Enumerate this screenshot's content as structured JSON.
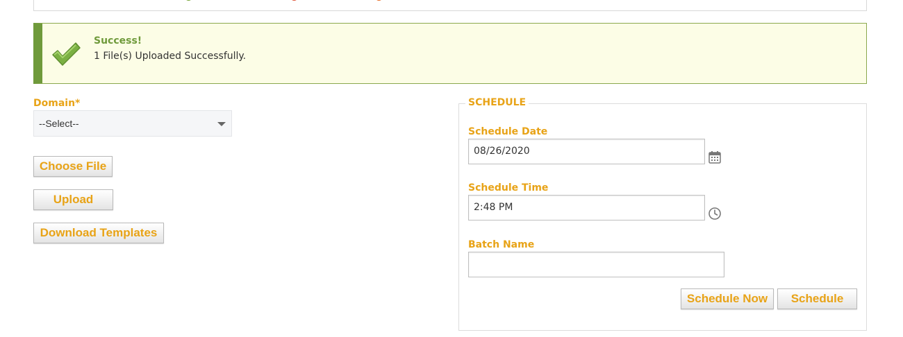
{
  "alert": {
    "title": "Success!",
    "message": "1 File(s) Uploaded Successfully."
  },
  "form": {
    "domain_label": "Domain*",
    "domain_selected": "--Select--",
    "choose_file_label": "Choose File",
    "upload_label": "Upload",
    "download_templates_label": "Download Templates"
  },
  "schedule": {
    "legend": "SCHEDULE",
    "date_label": "Schedule Date",
    "date_value": "08/26/2020",
    "time_label": "Schedule Time",
    "time_value": "2:48 PM",
    "batch_label": "Batch Name",
    "batch_value": "",
    "schedule_now_label": "Schedule Now",
    "schedule_label": "Schedule"
  },
  "icons": {
    "success": "check-icon",
    "date": "calendar-icon",
    "time": "clock-icon",
    "dropdown": "chevron-down-icon"
  },
  "colors": {
    "accent": "#e8a317",
    "success": "#6f9a3b",
    "alert_bg": "#fcfde6"
  }
}
